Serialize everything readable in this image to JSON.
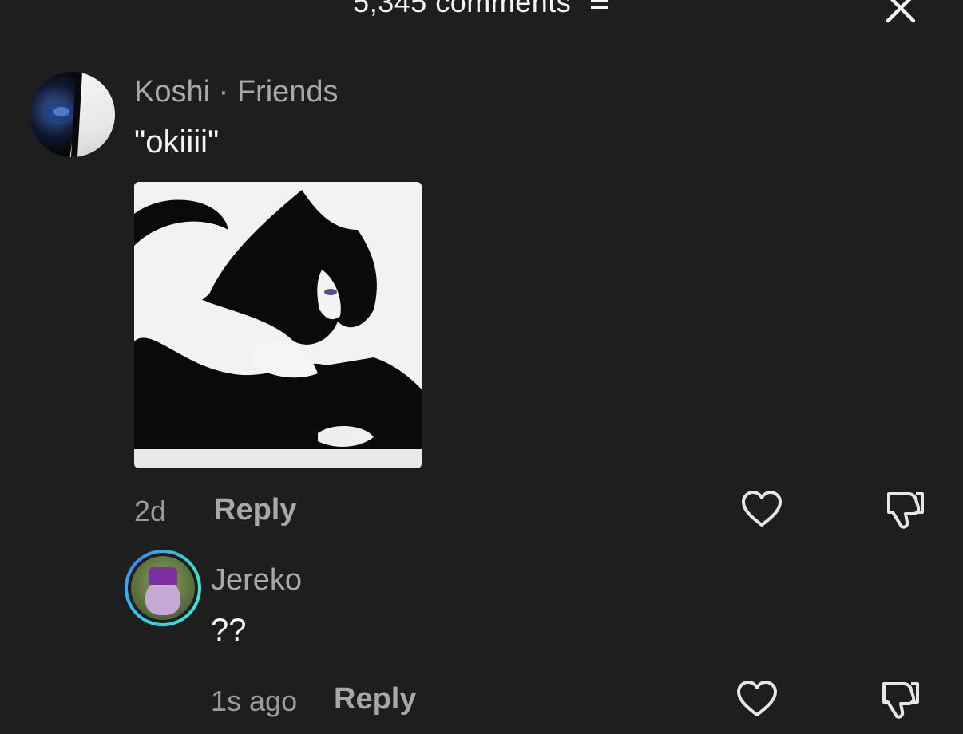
{
  "header": {
    "title": "5,345 comments",
    "sort_icon": "sort-icon",
    "close_icon": "close-icon"
  },
  "comments": [
    {
      "username": "Koshi",
      "relation": " · Friends",
      "text": "\"okiiii\"",
      "time": "2d",
      "reply_label": "Reply",
      "has_image": true
    },
    {
      "username": "Jereko",
      "text": "??",
      "time": "1s ago",
      "reply_label": "Reply"
    }
  ],
  "colors": {
    "background": "#1e1e1e",
    "muted_text": "#a8a8a8",
    "primary_text": "#f4f4f4",
    "story_ring": "#2fd3e8"
  }
}
